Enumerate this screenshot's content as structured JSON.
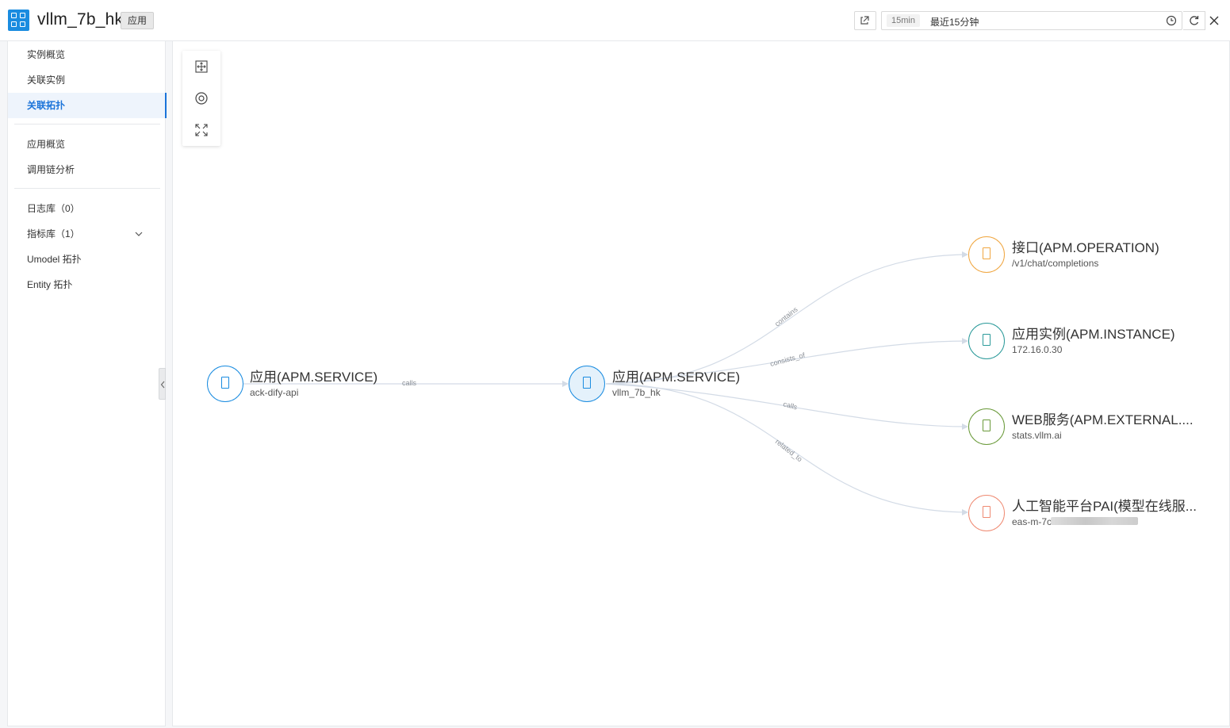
{
  "header": {
    "app_title": "vllm_7b_hk",
    "badge": "应用",
    "time_preset": "15min",
    "time_range": "最近15分钟"
  },
  "sidebar": {
    "group1": [
      "实例概览",
      "关联实例",
      "关联拓扑"
    ],
    "group2": [
      "应用概览",
      "调用链分析"
    ],
    "group3": [
      "日志库（0）",
      "指标库（1）",
      "Umodel 拓扑",
      "Entity 拓扑"
    ],
    "active": "关联拓扑"
  },
  "graph": {
    "nodes": [
      {
        "title": "应用(APM.SERVICE)",
        "subtitle": "ack-dify-api",
        "color": "#1a8ce0"
      },
      {
        "title": "应用(APM.SERVICE)",
        "subtitle": "vllm_7b_hk",
        "color": "#1a8ce0"
      },
      {
        "title": "接口(APM.OPERATION)",
        "subtitle": "/v1/chat/completions",
        "color": "#f0a640"
      },
      {
        "title": "应用实例(APM.INSTANCE)",
        "subtitle": "172.16.0.30",
        "color": "#2b9a9a"
      },
      {
        "title": "WEB服务(APM.EXTERNAL....",
        "subtitle": "stats.vllm.ai",
        "color": "#6a9a3a"
      },
      {
        "title": "人工智能平台PAI(模型在线服...",
        "subtitle": "eas-m-7c",
        "color": "#ef8a72"
      }
    ],
    "edges": [
      "calls",
      "contains",
      "consists_of",
      "calls",
      "related_to"
    ]
  },
  "colors": {
    "accent": "#1a73d9",
    "edge": "#d3dbe6"
  }
}
